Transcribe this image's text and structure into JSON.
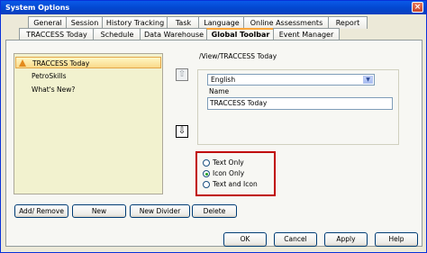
{
  "window": {
    "title": "System Options",
    "close_glyph": "×"
  },
  "tabs_row1": [
    "General",
    "Session",
    "History Tracking",
    "Task",
    "Language",
    "Online Assessments",
    "Report"
  ],
  "tabs_row2": [
    "TRACCESS Today",
    "Schedule",
    "Data Warehouse",
    "Global Toolbar",
    "Event Manager"
  ],
  "active_tab": "Global Toolbar",
  "toolbar_list": {
    "items": [
      {
        "label": "TRACCESS Today",
        "selected": true,
        "icon": "toolbar-item-icon"
      },
      {
        "label": "PetroSkills",
        "selected": false
      },
      {
        "label": "What's New?",
        "selected": false
      }
    ]
  },
  "list_buttons": {
    "add_remove": "Add/ Remove",
    "new": "New",
    "new_divider": "New Divider",
    "delete": "Delete"
  },
  "move_buttons": {
    "up_glyph": "⇧",
    "down_glyph": "⇩"
  },
  "details": {
    "path": "/View/TRACCESS Today",
    "language": "English",
    "name_label": "Name",
    "name_value": "TRACCESS Today"
  },
  "display_mode": {
    "options": [
      "Text Only",
      "Icon Only",
      "Text and Icon"
    ],
    "selected": "Icon Only"
  },
  "footer": {
    "ok": "OK",
    "cancel": "Cancel",
    "apply": "Apply",
    "help": "Help"
  },
  "colors": {
    "title_bar": "#0a5ae8",
    "highlight_border": "#c00000",
    "list_background": "#f2f2cf",
    "active_tab_accent": "#f9a53a"
  }
}
